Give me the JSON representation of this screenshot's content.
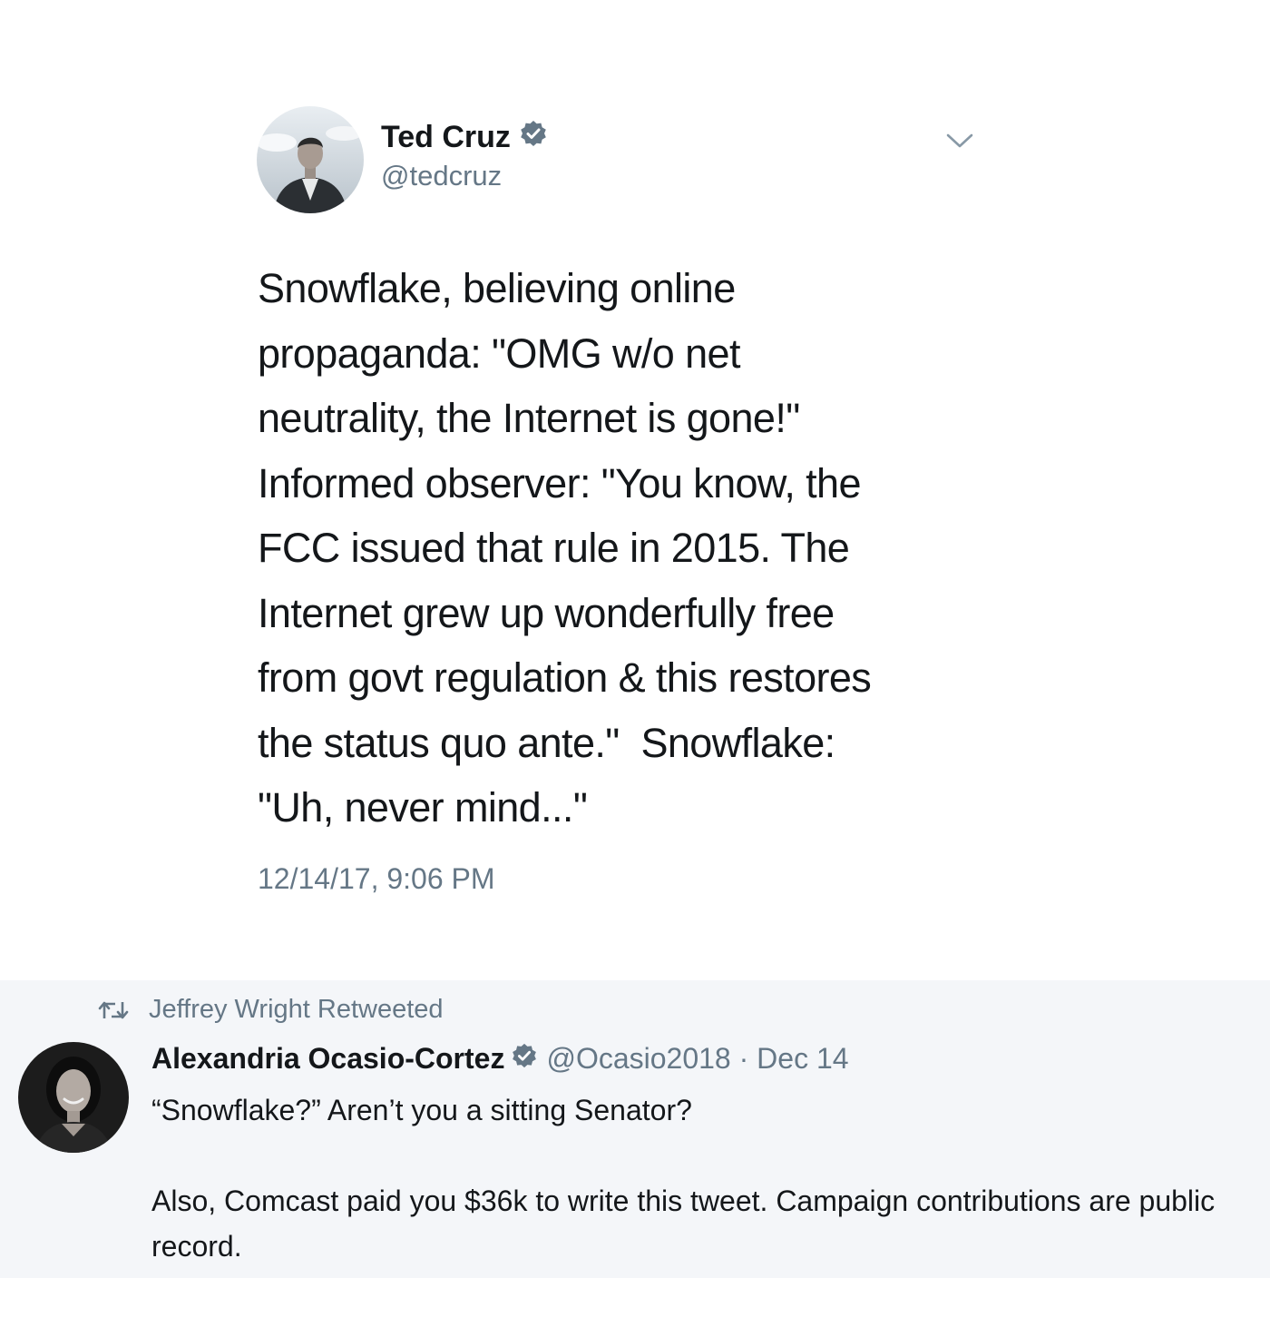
{
  "main_tweet": {
    "author_name": "Ted Cruz",
    "handle": "@tedcruz",
    "verified_icon": "verified-badge-icon",
    "menu_icon": "chevron-down-icon",
    "text_lines": [
      "Snowflake, believing online",
      "propaganda: \"OMG w/o net",
      "neutrality, the Internet is gone!\"",
      "Informed observer: \"You know, the",
      "FCC issued that rule in 2015. The",
      "Internet grew up wonderfully free",
      "from govt regulation & this restores",
      "the status quo ante.\"  Snowflake:",
      "\"Uh, never mind...\""
    ],
    "timestamp": "12/14/17, 9:06 PM"
  },
  "reply_tweet": {
    "retweeted_by": "Jeffrey Wright Retweeted",
    "retweet_icon": "retweet-icon",
    "author_name": "Alexandria Ocasio-Cortez",
    "handle_and_date": "@Ocasio2018 · Dec 14",
    "verified_icon": "verified-badge-icon",
    "text_para_1": "“Snowflake?” Aren’t you a sitting Senator?",
    "text_para_2": "Also, Comcast paid you $36k to write this tweet. Campaign contributions are public record."
  },
  "colors": {
    "text_primary": "#14171a",
    "text_secondary": "#657786",
    "card_background": "#f4f6f9",
    "verified_badge": "#657786"
  }
}
